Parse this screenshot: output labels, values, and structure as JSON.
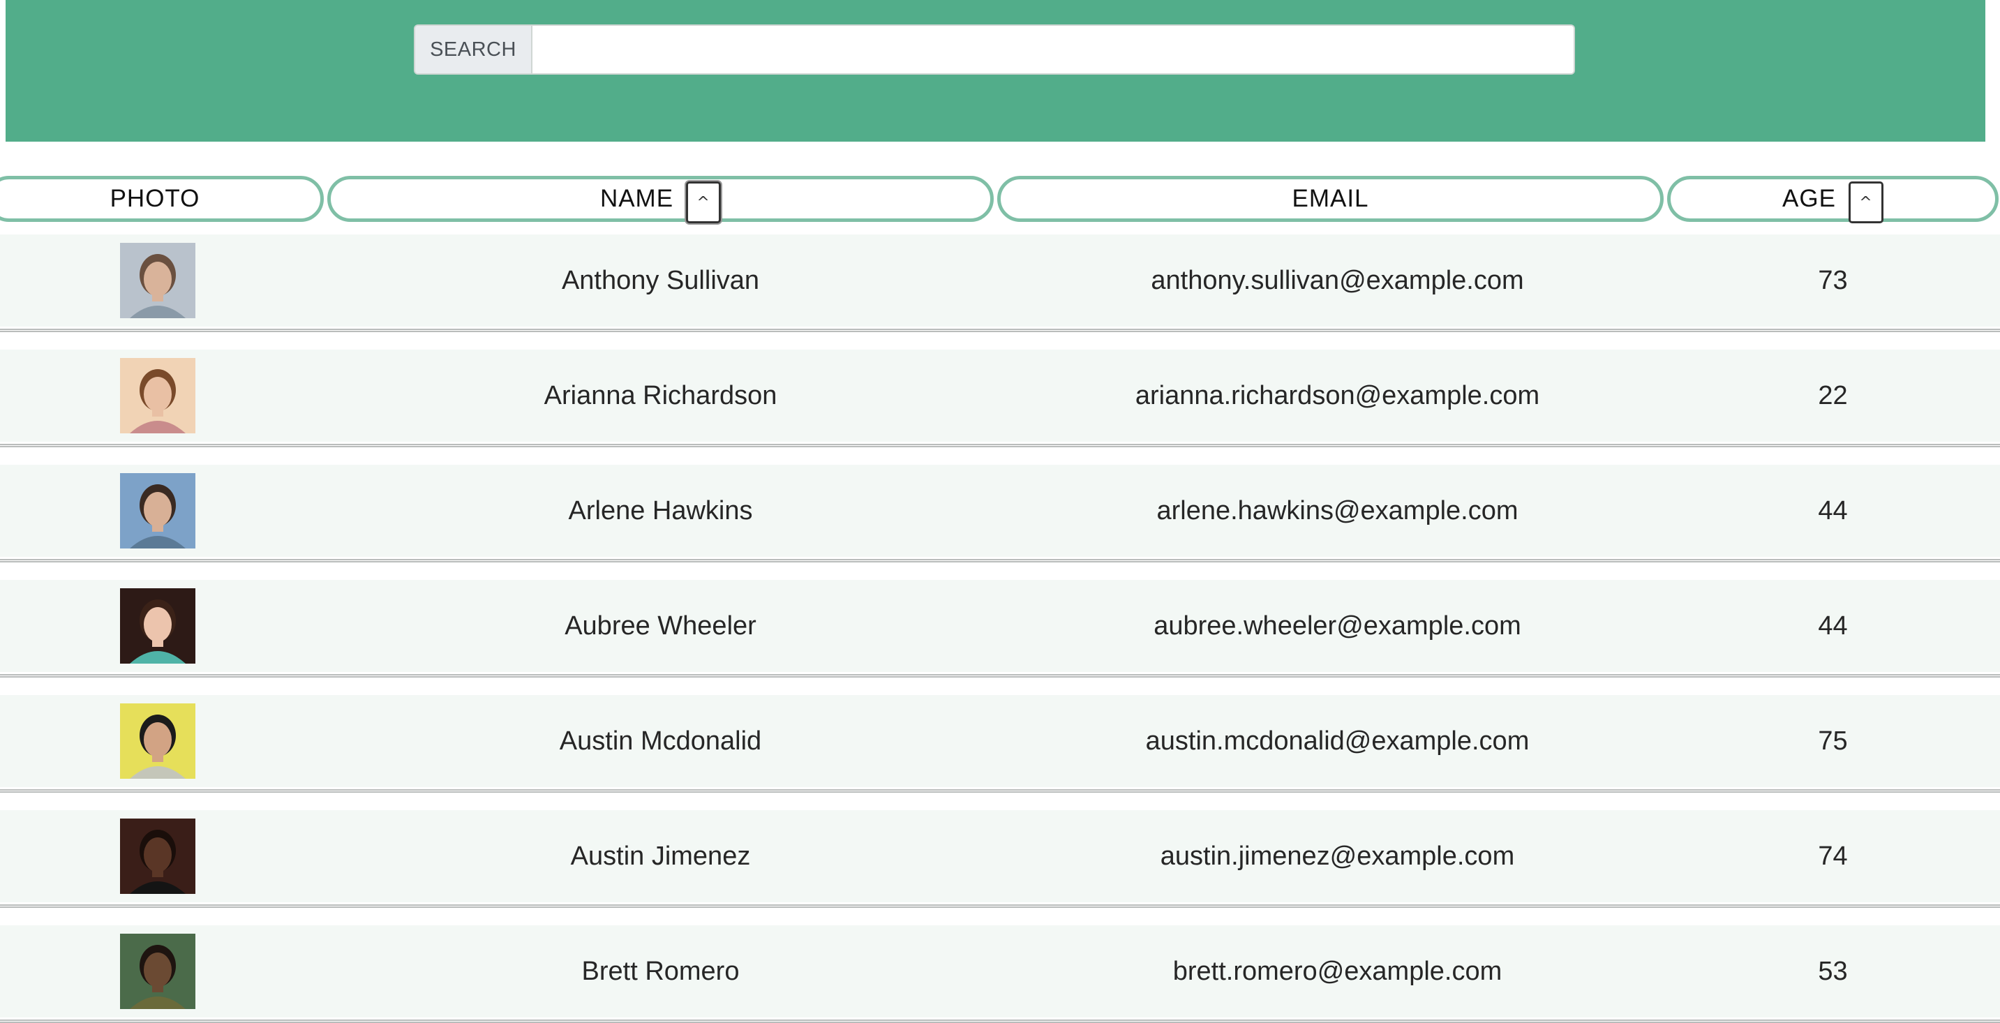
{
  "search": {
    "label": "SEARCH",
    "value": "",
    "placeholder": ""
  },
  "table": {
    "columns": [
      {
        "label": "PHOTO"
      },
      {
        "label": "NAME",
        "sort_symbol": "^"
      },
      {
        "label": "EMAIL"
      },
      {
        "label": "AGE",
        "sort_symbol": "^"
      }
    ],
    "rows": [
      {
        "name": "Anthony Sullivan",
        "email": "anthony.sullivan@example.com",
        "age": "73",
        "photo": "avatar-anthony-sullivan"
      },
      {
        "name": "Arianna Richardson",
        "email": "arianna.richardson@example.com",
        "age": "22",
        "photo": "avatar-arianna-richardson"
      },
      {
        "name": "Arlene Hawkins",
        "email": "arlene.hawkins@example.com",
        "age": "44",
        "photo": "avatar-arlene-hawkins"
      },
      {
        "name": "Aubree Wheeler",
        "email": "aubree.wheeler@example.com",
        "age": "44",
        "photo": "avatar-aubree-wheeler"
      },
      {
        "name": "Austin Mcdonalid",
        "email": "austin.mcdonalid@example.com",
        "age": "75",
        "photo": "avatar-austin-mcdonalid"
      },
      {
        "name": "Austin Jimenez",
        "email": "austin.jimenez@example.com",
        "age": "74",
        "photo": "avatar-austin-jimenez"
      },
      {
        "name": "Brett Romero",
        "email": "brett.romero@example.com",
        "age": "53",
        "photo": "avatar-brett-romero"
      }
    ]
  },
  "colors": {
    "banner": "#52ad8a",
    "header_border": "#7fbfa6",
    "row_background": "#f3f8f5"
  }
}
